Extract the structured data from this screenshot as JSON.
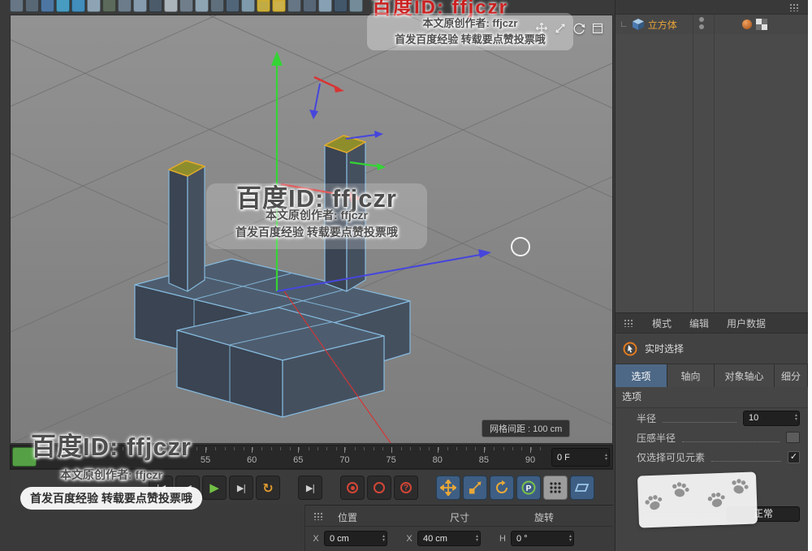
{
  "colors": {
    "accent_tab": "#4d6886",
    "axis_x": "#d83434",
    "axis_y": "#35d435",
    "axis_z": "#4646dd",
    "edge": "#86bade",
    "face_top": "#4d5d6f",
    "face_front": "#3a4452",
    "face_side": "#45505f",
    "highlight_top": "#8e8d2c",
    "highlight_edge": "#e2aa2c",
    "object_label": "#e8a43a",
    "play_green": "#72c045",
    "loop_orange": "#e09a30",
    "record_red": "#d24636",
    "tool_bg_blue": "#3e5e84"
  },
  "top_toolbar": {
    "icons": [
      {
        "name": "toolbar-icon-01",
        "color": "#6b7b8a"
      },
      {
        "name": "toolbar-icon-02",
        "color": "#5a6a78"
      },
      {
        "name": "toolbar-icon-03",
        "color": "#4f7ba8"
      },
      {
        "name": "toolbar-icon-04",
        "color": "#49a2c9"
      },
      {
        "name": "toolbar-icon-05",
        "color": "#4292c4"
      },
      {
        "name": "toolbar-icon-06",
        "color": "#93aabb"
      },
      {
        "name": "toolbar-icon-07",
        "color": "#5d6d5d"
      },
      {
        "name": "toolbar-icon-08",
        "color": "#70808f"
      },
      {
        "name": "toolbar-icon-09",
        "color": "#8ba1b5"
      },
      {
        "name": "toolbar-icon-10",
        "color": "#4d5d6d"
      },
      {
        "name": "toolbar-icon-11",
        "color": "#b2bac2"
      },
      {
        "name": "toolbar-icon-12",
        "color": "#72828f"
      },
      {
        "name": "toolbar-icon-13",
        "color": "#93abba"
      },
      {
        "name": "toolbar-icon-14",
        "color": "#62727f"
      },
      {
        "name": "toolbar-icon-15",
        "color": "#53687c"
      },
      {
        "name": "toolbar-icon-16",
        "color": "#83a0b0"
      },
      {
        "name": "toolbar-icon-17",
        "color": "#c9b245",
        "selected": true
      },
      {
        "name": "toolbar-icon-18",
        "color": "#d5b94c",
        "selected": true
      },
      {
        "name": "toolbar-icon-19",
        "color": "#6a7a89"
      },
      {
        "name": "toolbar-icon-20",
        "color": "#59697a"
      },
      {
        "name": "toolbar-icon-21",
        "color": "#8ca6ba"
      },
      {
        "name": "toolbar-icon-22",
        "color": "#44596e"
      },
      {
        "name": "toolbar-icon-23",
        "color": "#78919f"
      }
    ]
  },
  "viewport": {
    "grid_label": "网格间距 : 100 cm"
  },
  "object_manager": {
    "object_name": "立方体"
  },
  "attributes": {
    "menu_tabs": [
      "模式",
      "编辑",
      "用户数据"
    ],
    "tool_name": "实时选择",
    "sub_tabs": [
      {
        "label": "选项",
        "active": true
      },
      {
        "label": "轴向",
        "active": false
      },
      {
        "label": "对象轴心",
        "active": false
      },
      {
        "label": "细分",
        "active": false
      }
    ],
    "section_title": "选项",
    "rows": [
      {
        "name": "radius",
        "label": "半径",
        "type": "input",
        "value": "10"
      },
      {
        "name": "pressure-radius",
        "label": "压感半径",
        "type": "mini"
      },
      {
        "name": "only-select-visible",
        "label": "仅选择可见元素",
        "type": "checkbox",
        "checked": true,
        "check_glyph": "✓"
      },
      {
        "name": "mode",
        "label": "",
        "type": "select",
        "value": "正常"
      }
    ]
  },
  "timeline": {
    "labels": [
      "55",
      "60",
      "65",
      "70",
      "75",
      "80",
      "85",
      "90"
    ],
    "frame_field": "0 F"
  },
  "transport": {
    "buttons": [
      {
        "name": "goto-start-button",
        "kind": "text",
        "glyph": "|◀"
      },
      {
        "name": "prev-frame-button",
        "kind": "text",
        "glyph": "◀"
      },
      {
        "name": "play-button",
        "kind": "play",
        "glyph": "▶"
      },
      {
        "name": "next-frame-button",
        "kind": "text",
        "glyph": "▶|"
      },
      {
        "name": "loop-button",
        "kind": "loop",
        "glyph": "↻"
      },
      {
        "name": "goto-end-button",
        "kind": "text",
        "glyph": "▶|",
        "gap_before": true
      },
      {
        "name": "record-keyframe-button",
        "kind": "ring-dot",
        "gap_before": true
      },
      {
        "name": "autokey-button",
        "kind": "ring"
      },
      {
        "name": "record-options-button",
        "kind": "ring-q",
        "glyph": "?"
      },
      {
        "name": "move-tool-icon",
        "kind": "svg-move",
        "blue": true,
        "gap_before": true
      },
      {
        "name": "scale-tool-icon",
        "kind": "svg-scale",
        "blue": true
      },
      {
        "name": "rotate-tool-icon",
        "kind": "svg-rotate",
        "blue": true
      },
      {
        "name": "p-tool-icon",
        "kind": "svg-p",
        "blue": true
      },
      {
        "name": "grid-dots-icon",
        "kind": "svg-dots",
        "light": true
      },
      {
        "name": "workplane-icon",
        "kind": "svg-plane",
        "blue": true
      }
    ]
  },
  "coords": {
    "headers": [
      "位置",
      "尺寸",
      "旋转"
    ],
    "fields": [
      {
        "name": "position-x-field",
        "axis": "X",
        "value": "0 cm"
      },
      {
        "name": "size-x-field",
        "axis": "X",
        "value": "40 cm"
      },
      {
        "name": "rotation-h-field",
        "axis": "H",
        "value": "0 °"
      }
    ]
  },
  "watermarks": {
    "top_red": "百度ID: ffjczr",
    "top": {
      "line1": "本文原创作者: ffjczr",
      "line2": "首发百度经验 转载要点赞投票哦"
    },
    "center": {
      "title": "百度ID: ffjczr",
      "line1": "本文原创作者: ffjczr",
      "line2": "首发百度经验 转载要点赞投票哦"
    },
    "bottom_left": {
      "title": "百度ID: ffjczr",
      "line1": "本文原创作者: ffjczr",
      "line2": "首发百度经验 转载要点赞投票哦"
    }
  }
}
